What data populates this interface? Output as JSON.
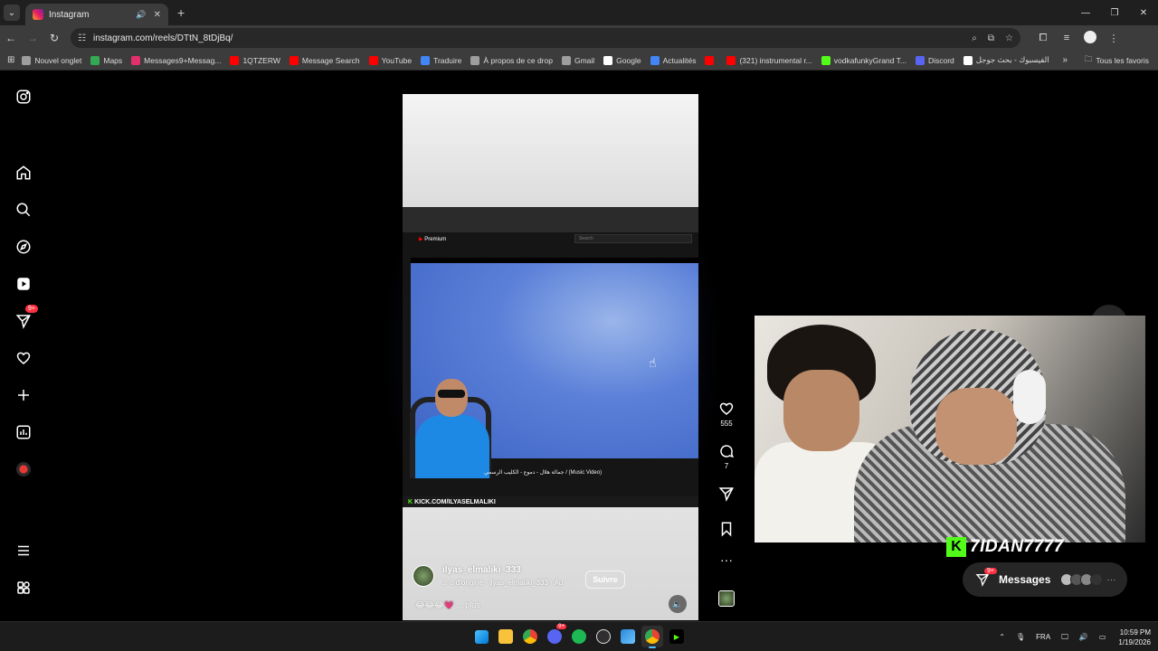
{
  "browser": {
    "tab_title": "Instagram",
    "url": "instagram.com/reels/DTtN_8tDjBq/",
    "bookmarks": [
      {
        "label": "Nouvel onglet",
        "color": "#9e9e9e"
      },
      {
        "label": "Maps",
        "color": "#34a853"
      },
      {
        "label": "Messages9+Messag...",
        "color": "#e1306c"
      },
      {
        "label": "1QTZERW",
        "color": "#ff0000"
      },
      {
        "label": "Message Search",
        "color": "#ff0000"
      },
      {
        "label": "YouTube",
        "color": "#ff0000"
      },
      {
        "label": "Traduire",
        "color": "#4285f4"
      },
      {
        "label": "À propos de ce drop",
        "color": "#9e9e9e"
      },
      {
        "label": "Gmail",
        "color": "#9e9e9e"
      },
      {
        "label": "Google",
        "color": "#ffffff"
      },
      {
        "label": "Actualités",
        "color": "#4285f4"
      },
      {
        "label": "",
        "color": "#ff0000"
      },
      {
        "label": "(321) instrumental r...",
        "color": "#ff0000"
      },
      {
        "label": "vodkafunkyGrand T...",
        "color": "#53fc18"
      },
      {
        "label": "Discord",
        "color": "#5865f2"
      },
      {
        "label": "الفيسبوك - بحث جوجل",
        "color": "#ffffff"
      }
    ],
    "all_bookmarks_label": "Tous les favoris"
  },
  "nav": {
    "notif_badge": "9+"
  },
  "reel": {
    "yt_premium": "Premium",
    "yt_search_placeholder": "Search",
    "video_caption": "جمالة هلال - دموع - الكليب الرسمي / (Music Video)",
    "kick_overlay": "KICK.COM/ILYASELMALIKI",
    "username": "ilyas_elmaliki_333",
    "audio": "o d'origine · ilyas_elmaliki_333 · Au",
    "follow_label": "Suivre",
    "caption_emojis": "😂😂😂💗",
    "caption_more": "... plus"
  },
  "actions": {
    "likes": "555",
    "comments": "7"
  },
  "stream": {
    "kick_name": "7IDAN7777"
  },
  "messages": {
    "label": "Messages",
    "badge": "9+"
  },
  "taskbar": {
    "discord_badge": "9+",
    "lang": "FRA",
    "time": "10:59 PM",
    "date": "1/19/2026"
  }
}
